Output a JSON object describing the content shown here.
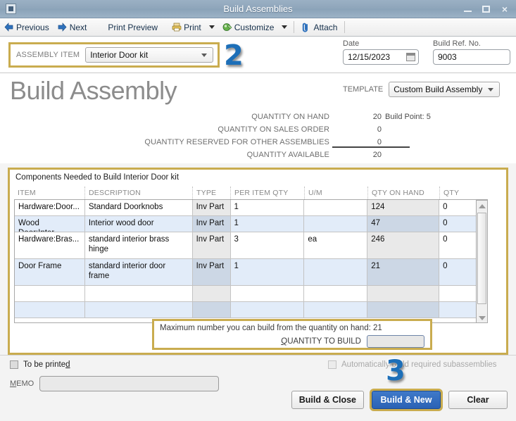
{
  "window": {
    "title": "Build Assemblies",
    "system_icon": "window-menu-icon",
    "minimize": "minimize-icon",
    "maximize": "maximize-icon",
    "close": "×"
  },
  "toolbar": {
    "previous": "Previous",
    "next": "Next",
    "print_preview": "Print Preview",
    "print": "Print",
    "customize": "Customize",
    "attach": "Attach"
  },
  "assembly": {
    "label": "ASSEMBLY ITEM",
    "value": "Interior Door kit",
    "badge": "2"
  },
  "date_field": {
    "label": "Date",
    "value": "12/15/2023"
  },
  "ref_field": {
    "label": "Build Ref. No.",
    "value": "9003"
  },
  "document": {
    "title": "Build Assembly",
    "template_label": "TEMPLATE",
    "template_value": "Custom Build Assembly"
  },
  "quantities": [
    {
      "label": "QUANTITY ON HAND",
      "value": "20",
      "extra": "Build Point: 5"
    },
    {
      "label": "QUANTITY ON SALES ORDER",
      "value": "0",
      "extra": ""
    },
    {
      "label": "QUANTITY RESERVED FOR OTHER ASSEMBLIES",
      "value": "0",
      "extra": ""
    },
    {
      "label": "QUANTITY AVAILABLE",
      "value": "20",
      "extra": ""
    }
  ],
  "components": {
    "title": "Components Needed to Build  Interior Door kit",
    "headers": {
      "item": "ITEM",
      "description": "DESCRIPTION",
      "type": "TYPE",
      "per_item_qty": "PER ITEM QTY",
      "um": "U/M",
      "qty_on_hand": "QTY ON HAND",
      "qty_needed": "QTY NEEDED"
    },
    "rows": [
      {
        "item": "Hardware:Door...",
        "description": "Standard Doorknobs",
        "type": "Inv Part",
        "per_item_qty": "1",
        "um": "",
        "qty_on_hand": "124",
        "qty_needed": "0"
      },
      {
        "item": "Wood Door:Inter...",
        "description": "Interior wood door",
        "type": "Inv Part",
        "per_item_qty": "1",
        "um": "",
        "qty_on_hand": "47",
        "qty_needed": "0"
      },
      {
        "item": "Hardware:Bras...",
        "description": "standard interior brass hinge",
        "type": "Inv Part",
        "per_item_qty": "3",
        "um": "ea",
        "qty_on_hand": "246",
        "qty_needed": "0"
      },
      {
        "item": "Door Frame",
        "description": "standard interior door frame",
        "type": "Inv Part",
        "per_item_qty": "1",
        "um": "",
        "qty_on_hand": "21",
        "qty_needed": "0"
      },
      {
        "item": "",
        "description": "",
        "type": "",
        "per_item_qty": "",
        "um": "",
        "qty_on_hand": "",
        "qty_needed": ""
      },
      {
        "item": "",
        "description": "",
        "type": "",
        "per_item_qty": "",
        "um": "",
        "qty_on_hand": "",
        "qty_needed": ""
      }
    ]
  },
  "max_build": {
    "text": "Maximum number you can build from the quantity on hand: 21",
    "qty_label_pre": "Q",
    "qty_label_post": "UANTITY TO BUILD",
    "qty_value": ""
  },
  "footer": {
    "to_be_printed_pre": "To be printe",
    "to_be_printed_post": "d",
    "memo_label_pre": "M",
    "memo_label_post": "EMO",
    "memo_value": "",
    "auto_build": "Automatically build required subassemblies",
    "badge": "3",
    "build_close": "Build & Close",
    "build_new": "Build & New",
    "clear": "Clear"
  },
  "colors": {
    "highlight_border": "#c9ac4f",
    "primary_button": "#2a62b4",
    "badge_blue": "#1d6fb8",
    "row_alt": "#e2ecf9"
  }
}
